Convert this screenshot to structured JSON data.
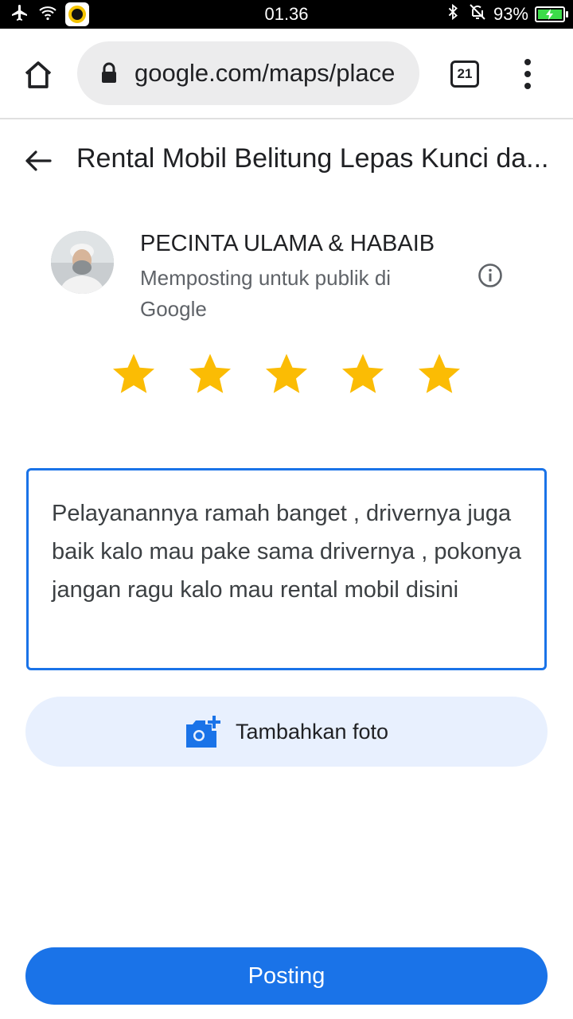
{
  "status_bar": {
    "time": "01.36",
    "battery_percent": "93%"
  },
  "browser": {
    "url": "google.com/maps/place",
    "tab_count": "21"
  },
  "header": {
    "title": "Rental Mobil Belitung Lepas Kunci da..."
  },
  "profile": {
    "name": "PECINTA ULAMA & HABAIB",
    "posting_note": "Memposting untuk publik di Google"
  },
  "rating": {
    "value": 5,
    "max": 5,
    "star_color": "#fbbc04"
  },
  "review": {
    "text": "Pelayanannya ramah banget , drivernya juga baik kalo mau pake sama drivernya , pokonya jangan ragu kalo mau rental mobil disini"
  },
  "actions": {
    "add_photo_label": "Tambahkan foto",
    "post_label": "Posting"
  },
  "colors": {
    "accent": "#1a73e8",
    "add_photo_bg": "#e8f0fe"
  }
}
